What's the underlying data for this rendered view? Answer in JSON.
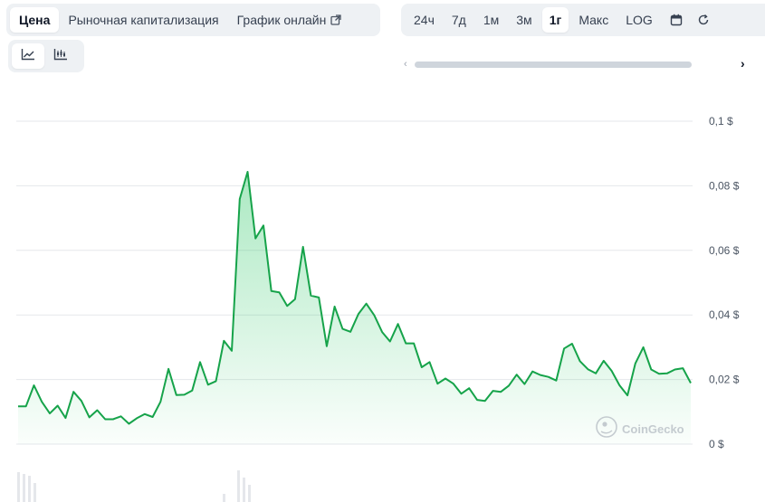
{
  "tabs": {
    "price": "Цена",
    "market_cap": "Рыночная капитализация",
    "live_chart": "График онлайн"
  },
  "ranges": {
    "h24": "24ч",
    "d7": "7д",
    "m1": "1м",
    "m3": "3м",
    "y1": "1г",
    "max": "Макс",
    "log": "LOG"
  },
  "watermark": "CoinGecko",
  "colors": {
    "line": "#16a34a",
    "area": "#22c55e",
    "grid": "#e5e7eb"
  },
  "chart_data": {
    "type": "area",
    "y_axis_position": "right",
    "ylim": [
      0,
      0.1
    ],
    "yticks": [
      "0 $",
      "0,02 $",
      "0,04 $",
      "0,06 $",
      "0,08 $",
      "0,1 $"
    ],
    "y": [
      0.0117,
      0.0117,
      0.0182,
      0.0131,
      0.0095,
      0.0119,
      0.0081,
      0.0162,
      0.0134,
      0.0083,
      0.0105,
      0.0077,
      0.0077,
      0.0086,
      0.0063,
      0.008,
      0.0093,
      0.0084,
      0.0131,
      0.0233,
      0.0152,
      0.0153,
      0.0166,
      0.0254,
      0.0184,
      0.0195,
      0.032,
      0.0289,
      0.0759,
      0.0843,
      0.0637,
      0.0677,
      0.0474,
      0.047,
      0.0428,
      0.0449,
      0.0611,
      0.046,
      0.0454,
      0.0303,
      0.0426,
      0.0357,
      0.0348,
      0.0403,
      0.0435,
      0.0399,
      0.0347,
      0.0318,
      0.0372,
      0.0312,
      0.0312,
      0.0238,
      0.0254,
      0.0187,
      0.0203,
      0.0187,
      0.0156,
      0.0173,
      0.0137,
      0.0134,
      0.0165,
      0.0162,
      0.0181,
      0.0215,
      0.0186,
      0.0225,
      0.0214,
      0.0208,
      0.0197,
      0.0296,
      0.0311,
      0.0257,
      0.0232,
      0.0219,
      0.0258,
      0.0227,
      0.0182,
      0.0151,
      0.025,
      0.03,
      0.0231,
      0.0218,
      0.0219,
      0.0231,
      0.0235,
      0.0189
    ]
  }
}
